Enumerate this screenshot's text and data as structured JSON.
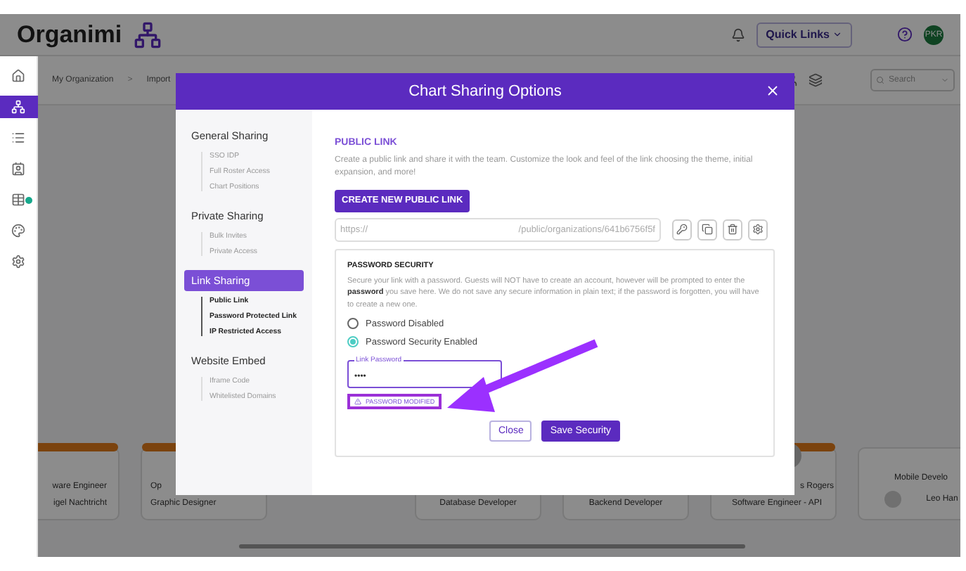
{
  "header": {
    "brand": "Organimi",
    "quick_links": "Quick Links",
    "avatar": "PKR"
  },
  "rail": [
    {
      "kind": "home",
      "selected": false,
      "badge": false
    },
    {
      "kind": "chart",
      "selected": true,
      "badge": false
    },
    {
      "kind": "list",
      "selected": false,
      "badge": false
    },
    {
      "kind": "contact",
      "selected": false,
      "badge": false
    },
    {
      "kind": "table",
      "selected": false,
      "badge": true
    },
    {
      "kind": "palette",
      "selected": false,
      "badge": false
    },
    {
      "kind": "settings",
      "selected": false,
      "badge": false
    }
  ],
  "breadcrumb": [
    {
      "kind": "link",
      "text": "My Organization"
    },
    {
      "kind": "separator",
      "text": ">"
    },
    {
      "kind": "link",
      "text": "Import"
    }
  ],
  "search": {
    "placeholder": "Search"
  },
  "cards": [
    {
      "kind": "plain",
      "accent": true,
      "lines": [
        "ware Engineer",
        "igel Nachtricht"
      ]
    },
    {
      "kind": "plain",
      "accent": true,
      "lines": [
        "Op",
        "Graphic Designer"
      ]
    },
    {
      "kind": "plain",
      "lines": [
        "Database Developer"
      ]
    },
    {
      "kind": "plain",
      "lines": [
        "Backend Developer"
      ]
    },
    {
      "kind": "avatar_top",
      "accent": true,
      "lines": [
        "s Rogers",
        "Software Engineer - API"
      ]
    },
    {
      "kind": "avatar_inline",
      "accent": false,
      "lines": [
        "Mobile Develo",
        "Leo Han"
      ]
    }
  ],
  "modal": {
    "title": "Chart Sharing Options",
    "nav": [
      {
        "heading": "General Sharing",
        "selected": false,
        "items": [
          "SSO IDP",
          "Full Roster Access",
          "Chart Positions"
        ]
      },
      {
        "heading": "Private Sharing",
        "selected": false,
        "items": [
          "Bulk Invites",
          "Private Access"
        ]
      },
      {
        "heading": "Link Sharing",
        "selected": true,
        "items": [
          "Public Link",
          "Password Protected Link",
          "IP Restricted Access"
        ]
      },
      {
        "heading": "Website Embed",
        "selected": false,
        "items": [
          "Iframe Code",
          "Whitelisted Domains"
        ]
      }
    ],
    "section_title": "PUBLIC LINK",
    "description": "Create a public link and share it with the team. Customize the look and feel of the link choosing the theme, initial expansion, and more!",
    "create_button": "CREATE NEW PUBLIC LINK",
    "url": {
      "scheme": "https://",
      "path": "/public/organizations/641b6756f5f"
    },
    "password": {
      "title": "PASSWORD SECURITY",
      "description": "Secure your link with a password. Guests will NOT have to create an account, however will be prompted to enter the **password** you save here. We do not save any secure information in plain text; if the password is forgotten, you will have to create a new one.",
      "options": [
        {
          "label": "Password Disabled",
          "selected": false
        },
        {
          "label": "Password Security Enabled",
          "selected": true
        }
      ],
      "field_label": "Link Password",
      "field_value": "••••",
      "warning": "PASSWORD MODIFIED",
      "close": "Close",
      "save": "Save Security"
    }
  }
}
